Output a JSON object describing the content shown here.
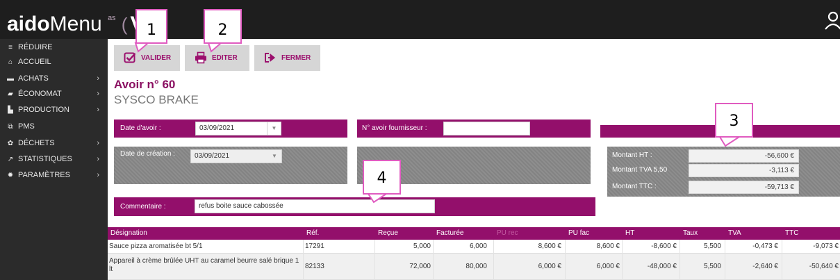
{
  "header": {
    "logo_bold": "aido",
    "logo_light": "Menu",
    "logo_extra": "ᵃˢ",
    "logo_v": "V"
  },
  "sidebar": {
    "items": [
      {
        "label": "RÉDUIRE",
        "icon": "menu-icon",
        "has_chevron": false
      },
      {
        "label": "ACCUEIL",
        "icon": "home-icon",
        "has_chevron": false
      },
      {
        "label": "ACHATS",
        "icon": "cart-icon",
        "has_chevron": true
      },
      {
        "label": "ÉCONOMAT",
        "icon": "truck-icon",
        "has_chevron": true
      },
      {
        "label": "PRODUCTION",
        "icon": "factory-icon",
        "has_chevron": true
      },
      {
        "label": "PMS",
        "icon": "pms-icon",
        "has_chevron": false
      },
      {
        "label": "DÉCHETS",
        "icon": "recycle-icon",
        "has_chevron": true
      },
      {
        "label": "STATISTIQUES",
        "icon": "chart-icon",
        "has_chevron": true
      },
      {
        "label": "PARAMÈTRES",
        "icon": "gear-icon",
        "has_chevron": true
      }
    ],
    "chevron": "›"
  },
  "toolbar": {
    "validate_label": "VALIDER",
    "edit_label": "EDITER",
    "close_label": "FERMER"
  },
  "callouts": [
    "1",
    "2",
    "3",
    "4"
  ],
  "page": {
    "title": "Avoir n° 60",
    "supplier": "SYSCO BRAKE"
  },
  "form": {
    "credit_date_label": "Date d'avoir :",
    "credit_date_value": "03/09/2021",
    "supplier_credit_no_label": "N° avoir fournisseur :",
    "supplier_credit_no_value": "",
    "creation_date_label": "Date de création :",
    "creation_date_value": "03/09/2021",
    "comment_label": "Commentaire :",
    "comment_value": "refus boite sauce cabossée",
    "dropdown_arrow": "▼"
  },
  "totals": [
    {
      "label": "Montant HT :",
      "value": "-56,600 €"
    },
    {
      "label": "Montant TVA 5,50",
      "value": "-3,113 €"
    },
    {
      "label": "Montant TTC :",
      "value": "-59,713 €"
    }
  ],
  "table": {
    "columns": [
      "Désignation",
      "Réf.",
      "Reçue",
      "Facturée",
      "PU rec",
      "PU fac",
      "HT",
      "Taux",
      "TVA",
      "TTC"
    ],
    "rows": [
      [
        "Sauce pizza aromatisée bt 5/1",
        "17291",
        "5,000",
        "6,000",
        "8,600 €",
        "8,600 €",
        "-8,600 €",
        "5,500",
        "-0,473 €",
        "-9,073 €"
      ],
      [
        "Appareil à crème brûlée UHT au caramel beurre salé brique 1 lt",
        "82133",
        "72,000",
        "80,000",
        "6,000 €",
        "6,000 €",
        "-48,000 €",
        "5,500",
        "-2,640 €",
        "-50,640 €"
      ]
    ]
  },
  "colors": {
    "accent": "#930f6b",
    "sidebar": "#2b2b2b",
    "topbar": "#1e1e1e",
    "callout_border": "#e05bc0"
  }
}
